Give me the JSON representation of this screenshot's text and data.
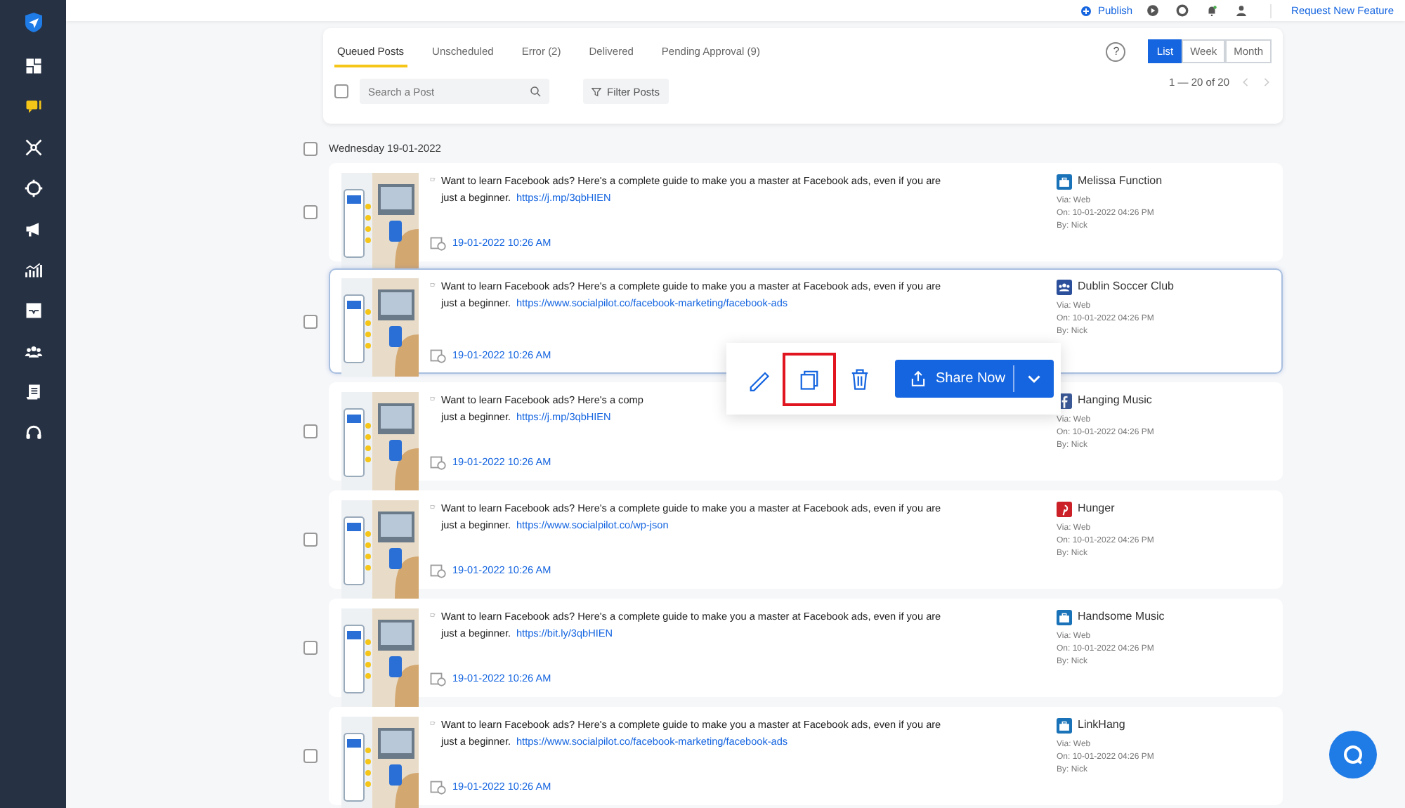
{
  "sidebar": {
    "items": [
      {
        "kind": "dashboard",
        "selected": false
      },
      {
        "kind": "posts",
        "selected": true
      },
      {
        "kind": "network",
        "selected": false
      },
      {
        "kind": "target",
        "selected": false
      },
      {
        "kind": "megaphone",
        "selected": false
      },
      {
        "kind": "chart",
        "selected": false
      },
      {
        "kind": "inbox",
        "selected": false
      },
      {
        "kind": "team",
        "selected": false
      },
      {
        "kind": "document",
        "selected": false
      },
      {
        "kind": "headset",
        "selected": false
      }
    ]
  },
  "topbar": {
    "publish": "Publish",
    "request_link": "Request New Feature"
  },
  "tabs": [
    {
      "label": "Queued Posts",
      "selected": true
    },
    {
      "label": "Unscheduled",
      "selected": false
    },
    {
      "label": "Error (2)",
      "selected": false
    },
    {
      "label": "Delivered",
      "selected": false
    },
    {
      "label": "Pending Approval (9)",
      "selected": false
    }
  ],
  "select_all": {
    "checked": false
  },
  "search": {
    "placeholder": "Search a Post"
  },
  "filter_button": "Filter Posts",
  "help": "?",
  "views": [
    {
      "label": "List",
      "selected": true
    },
    {
      "label": "Week",
      "selected": false
    },
    {
      "label": "Month",
      "selected": false
    }
  ],
  "pagination": "1 — 20 of 20",
  "day": {
    "label": "Wednesday 19-01-2022",
    "checked": false
  },
  "posts": [
    {
      "checked": false,
      "line_1": "Want to learn Facebook ads? Here's a complete guide to make you a master at Facebook ads, even if you are",
      "line_2": "just a beginner.",
      "link": "https://j.mp/3qbHIEN",
      "date": "19-01-2022 10:26 AM",
      "account": "Melissa Function",
      "kind": "page",
      "via": "Via: Web",
      "on": "On: 10-01-2022 04:26 PM",
      "by": "By: Nick",
      "highlighted": false
    },
    {
      "checked": false,
      "line_1": "Want to learn Facebook ads? Here's a complete guide to make you a master at Facebook ads, even if you are",
      "line_2": "just a beginner.",
      "link": "https://www.socialpilot.co/facebook-marketing/facebook-ads",
      "date": "19-01-2022 10:26 AM",
      "account": "Dublin Soccer Club",
      "kind": "group",
      "via": "Via: Web",
      "on": "On: 10-01-2022 04:26 PM",
      "by": "By: Nick",
      "highlighted": true
    },
    {
      "checked": false,
      "line_1": "Want to learn Facebook ads? Here's a comp",
      "line_2": "just a beginner.",
      "link": "https://j.mp/3qbHIEN",
      "date": "19-01-2022 10:26 AM",
      "account": "Hanging Music",
      "kind": "facebook",
      "via": "Via: Web",
      "on": "On: 10-01-2022 04:26 PM",
      "by": "By: Nick",
      "highlighted": false
    },
    {
      "checked": false,
      "line_1": "Want to learn Facebook ads? Here's a complete guide to make you a master at Facebook ads, even if you are",
      "line_2": "just a beginner.",
      "link": "https://www.socialpilot.co/wp-json",
      "date": "19-01-2022 10:26 AM",
      "account": "Hunger",
      "kind": "pinterest",
      "via": "Via: Web",
      "on": "On: 10-01-2022 04:26 PM",
      "by": "By: Nick",
      "highlighted": false
    },
    {
      "checked": false,
      "line_1": "Want to learn Facebook ads? Here's a complete guide to make you a master at Facebook ads, even if you are",
      "line_2": "just a beginner.",
      "link": "https://bit.ly/3qbHIEN",
      "date": "19-01-2022 10:26 AM",
      "account": "Handsome Music",
      "kind": "page",
      "via": "Via: Web",
      "on": "On: 10-01-2022 04:26 PM",
      "by": "By: Nick",
      "highlighted": false
    },
    {
      "checked": false,
      "line_1": "Want to learn Facebook ads? Here's a complete guide to make you a master at Facebook ads, even if you are",
      "line_2": "just a beginner.",
      "link": "https://www.socialpilot.co/facebook-marketing/facebook-ads",
      "date": "19-01-2022 10:26 AM",
      "account": "LinkHang",
      "kind": "page",
      "via": "Via: Web",
      "on": "On: 10-01-2022 04:26 PM",
      "by": "By: Nick",
      "highlighted": false
    }
  ],
  "action_popup": {
    "share_button": "Share Now",
    "copy_highlighted": true
  }
}
